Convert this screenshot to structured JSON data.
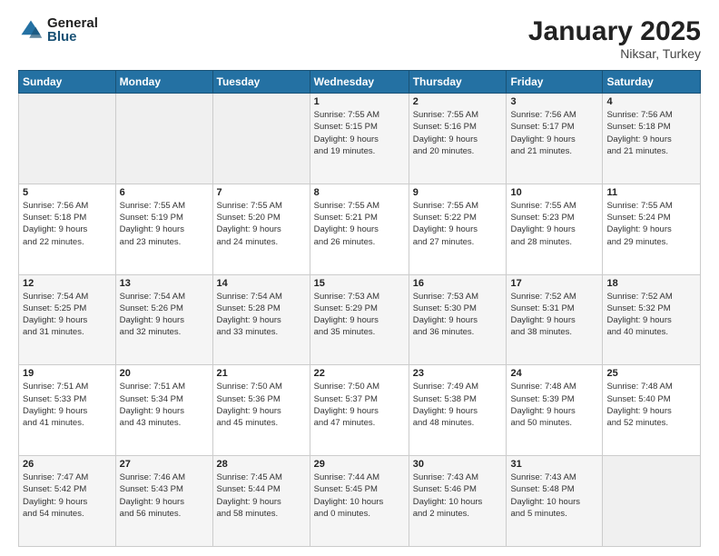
{
  "logo": {
    "general": "General",
    "blue": "Blue"
  },
  "title": "January 2025",
  "location": "Niksar, Turkey",
  "days_header": [
    "Sunday",
    "Monday",
    "Tuesday",
    "Wednesday",
    "Thursday",
    "Friday",
    "Saturday"
  ],
  "weeks": [
    [
      {
        "day": "",
        "info": ""
      },
      {
        "day": "",
        "info": ""
      },
      {
        "day": "",
        "info": ""
      },
      {
        "day": "1",
        "info": "Sunrise: 7:55 AM\nSunset: 5:15 PM\nDaylight: 9 hours\nand 19 minutes."
      },
      {
        "day": "2",
        "info": "Sunrise: 7:55 AM\nSunset: 5:16 PM\nDaylight: 9 hours\nand 20 minutes."
      },
      {
        "day": "3",
        "info": "Sunrise: 7:56 AM\nSunset: 5:17 PM\nDaylight: 9 hours\nand 21 minutes."
      },
      {
        "day": "4",
        "info": "Sunrise: 7:56 AM\nSunset: 5:18 PM\nDaylight: 9 hours\nand 21 minutes."
      }
    ],
    [
      {
        "day": "5",
        "info": "Sunrise: 7:56 AM\nSunset: 5:18 PM\nDaylight: 9 hours\nand 22 minutes."
      },
      {
        "day": "6",
        "info": "Sunrise: 7:55 AM\nSunset: 5:19 PM\nDaylight: 9 hours\nand 23 minutes."
      },
      {
        "day": "7",
        "info": "Sunrise: 7:55 AM\nSunset: 5:20 PM\nDaylight: 9 hours\nand 24 minutes."
      },
      {
        "day": "8",
        "info": "Sunrise: 7:55 AM\nSunset: 5:21 PM\nDaylight: 9 hours\nand 26 minutes."
      },
      {
        "day": "9",
        "info": "Sunrise: 7:55 AM\nSunset: 5:22 PM\nDaylight: 9 hours\nand 27 minutes."
      },
      {
        "day": "10",
        "info": "Sunrise: 7:55 AM\nSunset: 5:23 PM\nDaylight: 9 hours\nand 28 minutes."
      },
      {
        "day": "11",
        "info": "Sunrise: 7:55 AM\nSunset: 5:24 PM\nDaylight: 9 hours\nand 29 minutes."
      }
    ],
    [
      {
        "day": "12",
        "info": "Sunrise: 7:54 AM\nSunset: 5:25 PM\nDaylight: 9 hours\nand 31 minutes."
      },
      {
        "day": "13",
        "info": "Sunrise: 7:54 AM\nSunset: 5:26 PM\nDaylight: 9 hours\nand 32 minutes."
      },
      {
        "day": "14",
        "info": "Sunrise: 7:54 AM\nSunset: 5:28 PM\nDaylight: 9 hours\nand 33 minutes."
      },
      {
        "day": "15",
        "info": "Sunrise: 7:53 AM\nSunset: 5:29 PM\nDaylight: 9 hours\nand 35 minutes."
      },
      {
        "day": "16",
        "info": "Sunrise: 7:53 AM\nSunset: 5:30 PM\nDaylight: 9 hours\nand 36 minutes."
      },
      {
        "day": "17",
        "info": "Sunrise: 7:52 AM\nSunset: 5:31 PM\nDaylight: 9 hours\nand 38 minutes."
      },
      {
        "day": "18",
        "info": "Sunrise: 7:52 AM\nSunset: 5:32 PM\nDaylight: 9 hours\nand 40 minutes."
      }
    ],
    [
      {
        "day": "19",
        "info": "Sunrise: 7:51 AM\nSunset: 5:33 PM\nDaylight: 9 hours\nand 41 minutes."
      },
      {
        "day": "20",
        "info": "Sunrise: 7:51 AM\nSunset: 5:34 PM\nDaylight: 9 hours\nand 43 minutes."
      },
      {
        "day": "21",
        "info": "Sunrise: 7:50 AM\nSunset: 5:36 PM\nDaylight: 9 hours\nand 45 minutes."
      },
      {
        "day": "22",
        "info": "Sunrise: 7:50 AM\nSunset: 5:37 PM\nDaylight: 9 hours\nand 47 minutes."
      },
      {
        "day": "23",
        "info": "Sunrise: 7:49 AM\nSunset: 5:38 PM\nDaylight: 9 hours\nand 48 minutes."
      },
      {
        "day": "24",
        "info": "Sunrise: 7:48 AM\nSunset: 5:39 PM\nDaylight: 9 hours\nand 50 minutes."
      },
      {
        "day": "25",
        "info": "Sunrise: 7:48 AM\nSunset: 5:40 PM\nDaylight: 9 hours\nand 52 minutes."
      }
    ],
    [
      {
        "day": "26",
        "info": "Sunrise: 7:47 AM\nSunset: 5:42 PM\nDaylight: 9 hours\nand 54 minutes."
      },
      {
        "day": "27",
        "info": "Sunrise: 7:46 AM\nSunset: 5:43 PM\nDaylight: 9 hours\nand 56 minutes."
      },
      {
        "day": "28",
        "info": "Sunrise: 7:45 AM\nSunset: 5:44 PM\nDaylight: 9 hours\nand 58 minutes."
      },
      {
        "day": "29",
        "info": "Sunrise: 7:44 AM\nSunset: 5:45 PM\nDaylight: 10 hours\nand 0 minutes."
      },
      {
        "day": "30",
        "info": "Sunrise: 7:43 AM\nSunset: 5:46 PM\nDaylight: 10 hours\nand 2 minutes."
      },
      {
        "day": "31",
        "info": "Sunrise: 7:43 AM\nSunset: 5:48 PM\nDaylight: 10 hours\nand 5 minutes."
      },
      {
        "day": "",
        "info": ""
      }
    ]
  ]
}
